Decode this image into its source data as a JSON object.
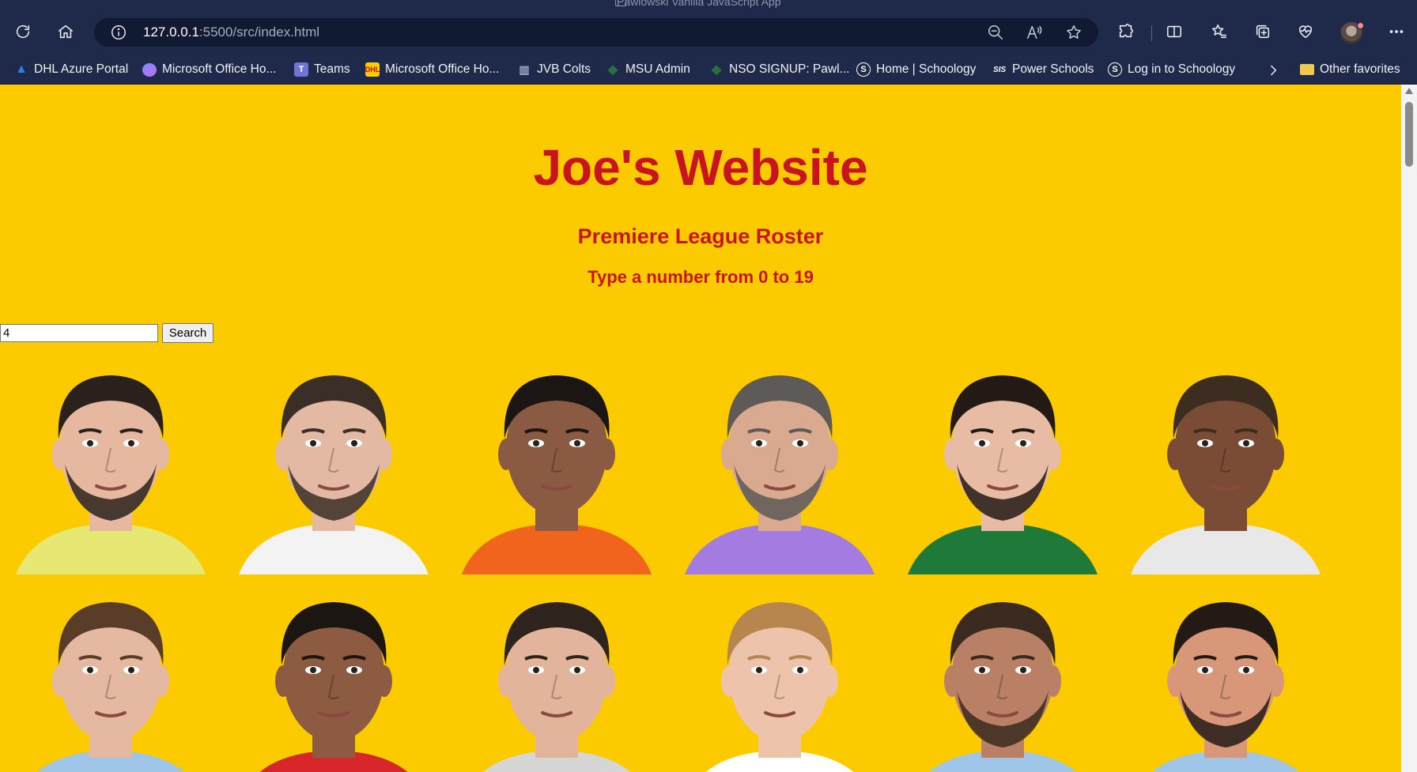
{
  "window": {
    "tab_title": "Pawlowski Vanilla JavaScript App"
  },
  "address_bar": {
    "url_host": "127.0.0.1",
    "url_rest": ":5500/src/index.html"
  },
  "favorites": [
    {
      "label": "DHL Azure Portal",
      "icon": "azure-icon",
      "color": "#2f7fe0"
    },
    {
      "label": "Microsoft Office Ho...",
      "icon": "office-icon",
      "color": "#7b8cff"
    },
    {
      "label": "Teams",
      "icon": "teams-icon",
      "color": "#6f74d9"
    },
    {
      "label": "Microsoft Office Ho...",
      "icon": "dhl-icon",
      "color": "#ffcc00"
    },
    {
      "label": "JVB Colts",
      "icon": "chart-icon",
      "color": "#9aa7c7"
    },
    {
      "label": "MSU Admin",
      "icon": "msu-icon",
      "color": "#2b6e44"
    },
    {
      "label": "NSO SIGNUP: Pawl...",
      "icon": "msu-icon",
      "color": "#2b6e44"
    },
    {
      "label": "Home | Schoology",
      "icon": "schoology-icon",
      "color": "#ffffff"
    },
    {
      "label": "Power Schools",
      "icon": "powerschool-icon",
      "color": "#3b5bb5"
    },
    {
      "label": "Log in to Schoology",
      "icon": "schoology-icon",
      "color": "#ffffff"
    }
  ],
  "other_favorites": "Other favorites",
  "page": {
    "title": "Joe's Website",
    "subtitle": "Premiere League Roster",
    "instruction": "Type a number from 0 to 19",
    "search_value": "4",
    "search_button": "Search"
  },
  "players": [
    {
      "skin": "#e6b8a0",
      "hair": "#2a211c",
      "shirt": "#e6e873",
      "beard": true
    },
    {
      "skin": "#e3b9a3",
      "hair": "#3a2e26",
      "shirt": "#f3f3f3",
      "beard": true
    },
    {
      "skin": "#8a5a42",
      "hair": "#1b1514",
      "shirt": "#f0641e",
      "beard": false
    },
    {
      "skin": "#d9a990",
      "hair": "#5d5a57",
      "shirt": "#a47be0",
      "beard": true
    },
    {
      "skin": "#e8bca4",
      "hair": "#231a16",
      "shirt": "#1f7a3a",
      "beard": true
    },
    {
      "skin": "#7a4c36",
      "hair": "#3d2d20",
      "shirt": "#e8e8e8",
      "beard": false
    },
    {
      "skin": "#e5b9a1",
      "hair": "#5a3d28",
      "shirt": "#9fc5e8",
      "beard": false
    },
    {
      "skin": "#8d5a42",
      "hair": "#1c1613",
      "shirt": "#d9262b",
      "beard": false
    },
    {
      "skin": "#e2b49c",
      "hair": "#2e231d",
      "shirt": "#d6d6d6",
      "beard": false
    },
    {
      "skin": "#eec3ab",
      "hair": "#b7864f",
      "shirt": "#ffffff",
      "beard": false
    },
    {
      "skin": "#b98066",
      "hair": "#3a2a1f",
      "shirt": "#9fc5e8",
      "beard": true
    },
    {
      "skin": "#d9977a",
      "hair": "#231a16",
      "shirt": "#9fc5e8",
      "beard": true
    }
  ]
}
